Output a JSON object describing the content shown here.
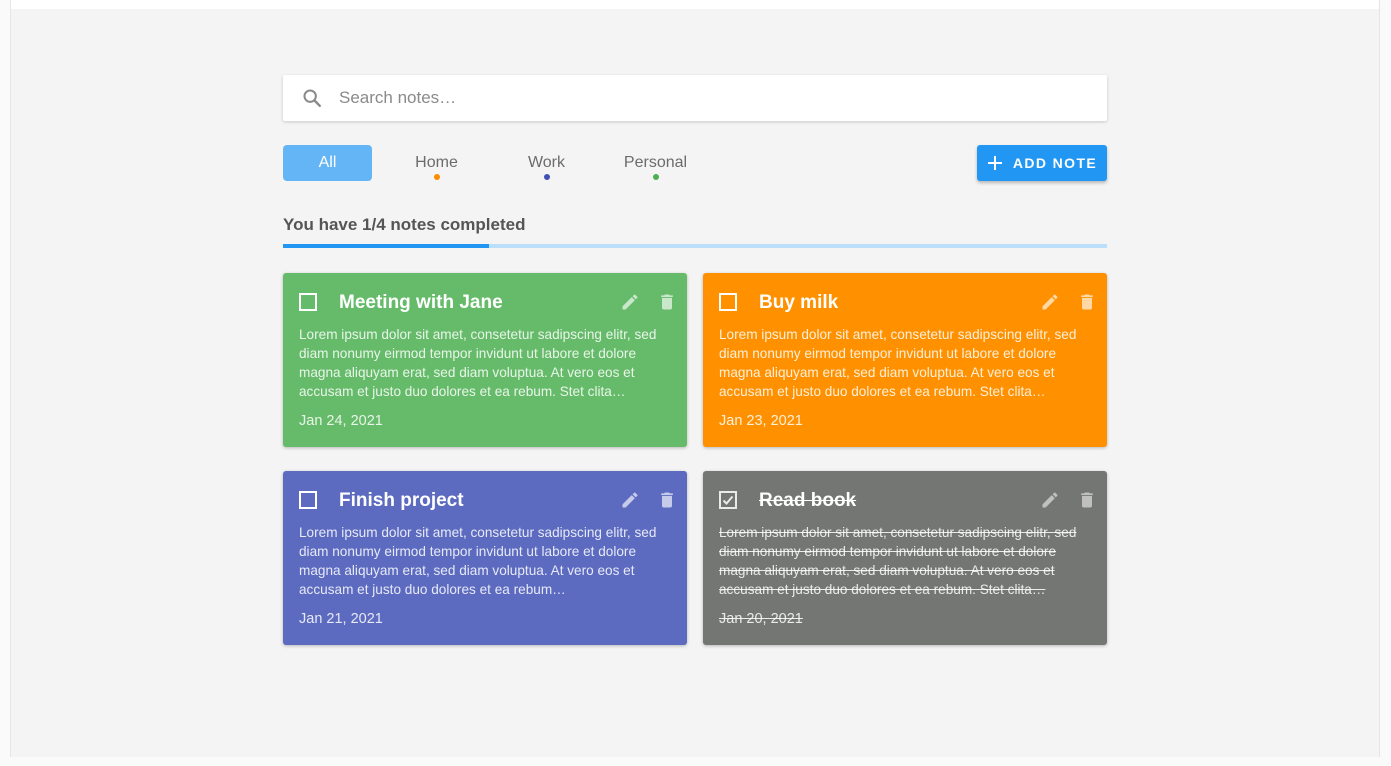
{
  "search": {
    "placeholder": "Search notes…",
    "value": ""
  },
  "filters": [
    {
      "label": "All",
      "active": true,
      "dot": null
    },
    {
      "label": "Home",
      "active": false,
      "dot": "#fb8c00"
    },
    {
      "label": "Work",
      "active": false,
      "dot": "#3f51b5"
    },
    {
      "label": "Personal",
      "active": false,
      "dot": "#4caf50"
    }
  ],
  "add_button": {
    "label": "ADD NOTE",
    "icon": "plus-icon",
    "color": "#2196f3"
  },
  "progress": {
    "text": "You have 1/4 notes completed",
    "completed": 1,
    "total": 4,
    "fraction": 0.25
  },
  "notes": [
    {
      "title": "Meeting with Jane",
      "body": "Lorem ipsum dolor sit amet, consetetur sadipscing elitr, sed diam nonumy eirmod tempor invidunt ut labore et dolore magna aliquyam erat, sed diam voluptua. At vero eos et accusam et justo duo dolores et ea rebum. Stet clita…",
      "date": "Jan 24, 2021",
      "color": "#66bb6a",
      "completed": false
    },
    {
      "title": "Buy milk",
      "body": "Lorem ipsum dolor sit amet, consetetur sadipscing elitr, sed diam nonumy eirmod tempor invidunt ut labore et dolore magna aliquyam erat, sed diam voluptua. At vero eos et accusam et justo duo dolores et ea rebum. Stet clita…",
      "date": "Jan 23, 2021",
      "color": "#ff9100",
      "completed": false
    },
    {
      "title": "Finish project",
      "body": "Lorem ipsum dolor sit amet, consetetur sadipscing elitr, sed diam nonumy eirmod tempor invidunt ut labore et dolore magna aliquyam erat, sed diam voluptua. At vero eos et accusam et justo duo dolores et ea rebum…",
      "date": "Jan 21, 2021",
      "color": "#5c6bc0",
      "completed": false
    },
    {
      "title": "Read book",
      "body": "Lorem ipsum dolor sit amet, consetetur sadipscing elitr, sed diam nonumy eirmod tempor invidunt ut labore et dolore magna aliquyam erat, sed diam voluptua. At vero eos et accusam et justo duo dolores et ea rebum. Stet clita…",
      "date": "Jan 20, 2021",
      "color": "#737672",
      "completed": true
    }
  ]
}
